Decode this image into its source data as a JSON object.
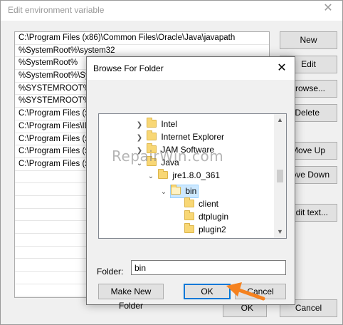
{
  "outer": {
    "title": "Edit environment variable",
    "env_values": [
      "C:\\Program Files (x86)\\Common Files\\Oracle\\Java\\javapath",
      "%SystemRoot%\\system32",
      "%SystemRoot%",
      "%SystemRoot%\\Sys",
      "%SYSTEMROOT%\\Sy",
      "%SYSTEMROOT%\\Sy",
      "C:\\Program Files (x8",
      "C:\\Program Files\\ID",
      "C:\\Program Files (x8",
      "C:\\Program Files (x8",
      "C:\\Program Files (x8"
    ],
    "buttons": {
      "new": "New",
      "edit": "Edit",
      "browse": "Browse...",
      "delete": "Delete",
      "move_up": "Move Up",
      "move_down": "ove Down",
      "edit_text": "dit text...",
      "ok": "OK",
      "cancel": "Cancel"
    }
  },
  "dialog": {
    "title": "Browse For Folder",
    "tree": {
      "intel": "Intel",
      "internet_explorer": "Internet Explorer",
      "jam_software": "JAM Software",
      "java": "Java",
      "jre": "jre1.8.0_361",
      "bin": "bin",
      "client": "client",
      "dtplugin": "dtplugin",
      "plugin2": "plugin2"
    },
    "folder_label": "Folder:",
    "folder_value": "bin",
    "buttons": {
      "make_new_folder": "Make New Folder",
      "ok": "OK",
      "cancel": "Cancel"
    }
  },
  "watermark": "RepairWin.com",
  "colors": {
    "selection": "#cce8ff",
    "accent": "#0078d7",
    "arrow": "#f58220",
    "folder": "#f8d775"
  }
}
